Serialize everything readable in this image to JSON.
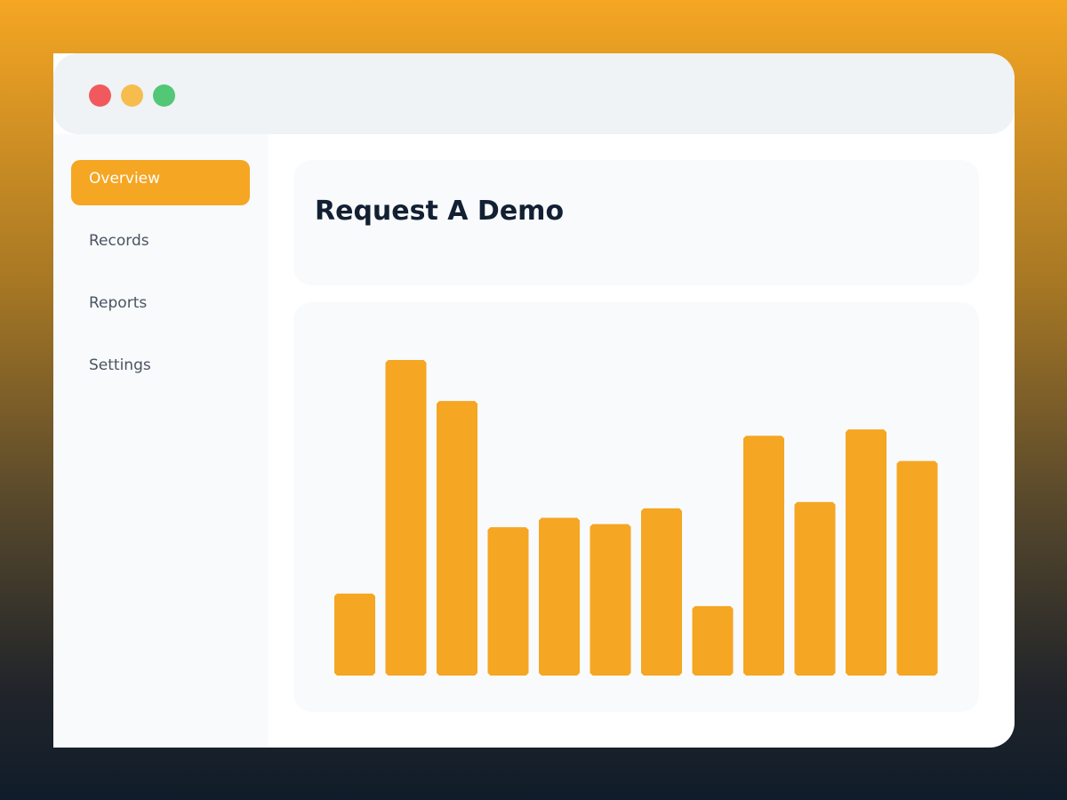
{
  "window": {
    "controls": [
      "close",
      "minimize",
      "maximize"
    ]
  },
  "sidebar": {
    "items": [
      {
        "label": "Overview",
        "active": true
      },
      {
        "label": "Records",
        "active": false
      },
      {
        "label": "Reports",
        "active": false
      },
      {
        "label": "Settings",
        "active": false
      }
    ]
  },
  "main": {
    "title": "Request A Demo"
  },
  "colors": {
    "accent": "#f5a623",
    "close": "#f05a5c",
    "minimize": "#f6bd4e",
    "maximize": "#52c776"
  },
  "chart_data": {
    "type": "bar",
    "title": "",
    "xlabel": "",
    "ylabel": "",
    "ylim": [
      0,
      100
    ],
    "grid": false,
    "categories": [
      "",
      "",
      "",
      "",
      "",
      "",
      "",
      "",
      "",
      "",
      "",
      ""
    ],
    "values": [
      26,
      100,
      87,
      47,
      50,
      48,
      53,
      22,
      76,
      55,
      78,
      68
    ]
  }
}
